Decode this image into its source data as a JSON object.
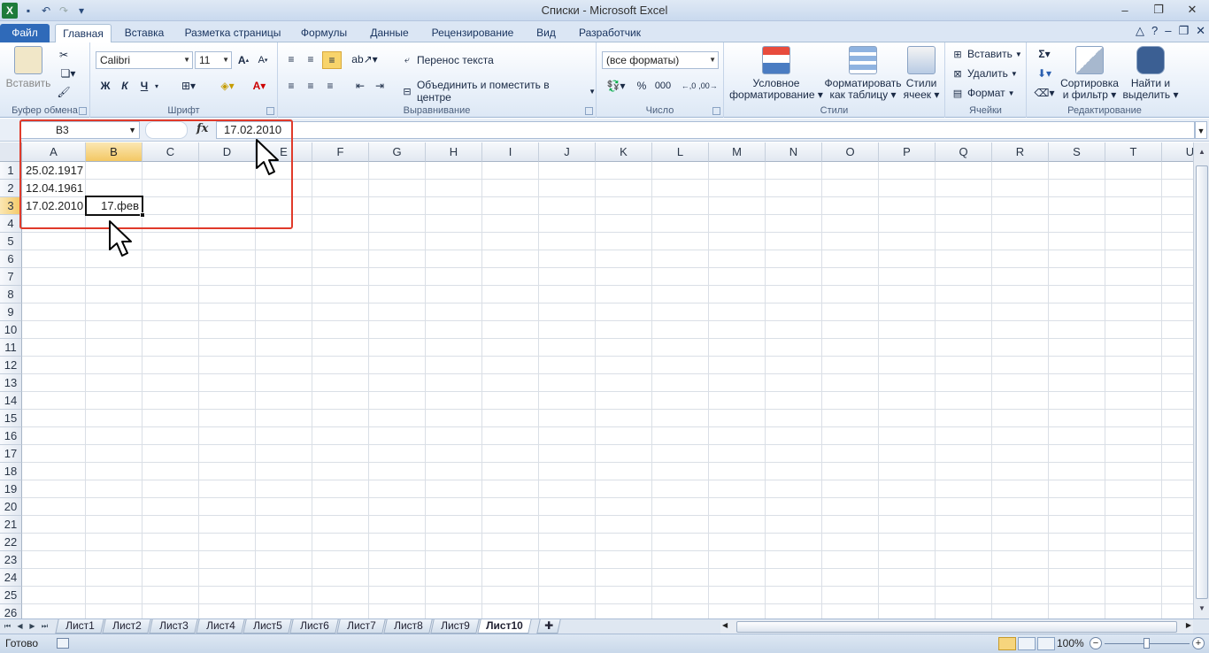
{
  "window": {
    "title": "Списки - Microsoft Excel"
  },
  "ribbon_tabs": [
    "Файл",
    "Главная",
    "Вставка",
    "Разметка страницы",
    "Формулы",
    "Данные",
    "Рецензирование",
    "Вид",
    "Разработчик"
  ],
  "ribbon": {
    "clipboard": {
      "paste_label": "Вставить",
      "group_label": "Буфер обмена"
    },
    "font": {
      "font_name": "Calibri",
      "font_size": "11",
      "bold": "Ж",
      "italic": "К",
      "underline": "Ч",
      "group_label": "Шрифт"
    },
    "alignment": {
      "wrap_text": "Перенос текста",
      "merge_center": "Объединить и поместить в центре",
      "group_label": "Выравнивание"
    },
    "number": {
      "format": "(все форматы)",
      "percent": "%",
      "thousands": "000",
      "group_label": "Число"
    },
    "styles": {
      "conditional_l1": "Условное",
      "conditional_l2": "форматирование",
      "table_l1": "Форматировать",
      "table_l2": "как таблицу",
      "cell_l1": "Стили",
      "cell_l2": "ячеек",
      "group_label": "Стили"
    },
    "cells": {
      "insert": "Вставить",
      "delete": "Удалить",
      "format": "Формат",
      "group_label": "Ячейки"
    },
    "editing": {
      "sort_l1": "Сортировка",
      "sort_l2": "и фильтр",
      "find_l1": "Найти и",
      "find_l2": "выделить",
      "group_label": "Редактирование"
    }
  },
  "formula_bar": {
    "name_box": "B3",
    "fx": "fx",
    "content": "17.02.2010"
  },
  "columns": [
    "A",
    "B",
    "C",
    "D",
    "E",
    "F",
    "G",
    "H",
    "I",
    "J",
    "K",
    "L",
    "M",
    "N",
    "O",
    "P",
    "Q",
    "R",
    "S",
    "T",
    "U"
  ],
  "rows": [
    "1",
    "2",
    "3",
    "4",
    "5",
    "6",
    "7",
    "8",
    "9",
    "10",
    "11",
    "12",
    "13",
    "14",
    "15",
    "16",
    "17",
    "18",
    "19",
    "20",
    "21",
    "22",
    "23",
    "24",
    "25",
    "26"
  ],
  "cells": {
    "A1": "25.02.1917",
    "A2": "12.04.1961",
    "A3": "17.02.2010",
    "B3": "17.фев"
  },
  "selected": {
    "column": "B",
    "row": "3"
  },
  "sheets": [
    "Лист1",
    "Лист2",
    "Лист3",
    "Лист4",
    "Лист5",
    "Лист6",
    "Лист7",
    "Лист8",
    "Лист9",
    "Лист10"
  ],
  "active_sheet": "Лист10",
  "status": {
    "ready": "Готово",
    "zoom": "100%"
  },
  "colors": {
    "highlight_box": "#e03a2a",
    "file_tab": "#2f6ab9",
    "selected_header": "#f3c864"
  }
}
